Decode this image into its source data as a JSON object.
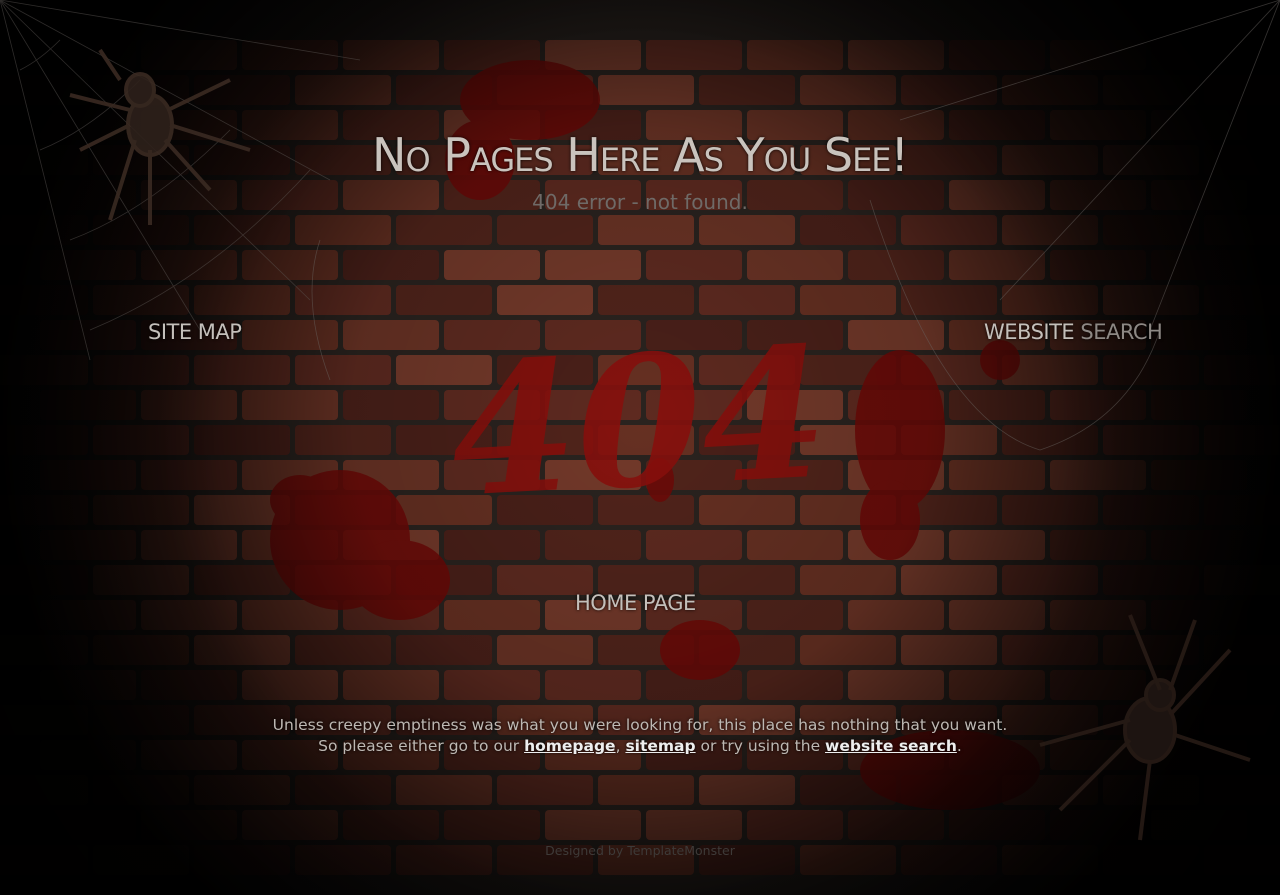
{
  "header": {
    "title": "No Pages Here As You See!",
    "subtitle": "404 error - not found."
  },
  "wall": {
    "graffiti_text": "404"
  },
  "nav": {
    "site_map": "SITE MAP",
    "website_search_part1": "WEBSITE",
    "website_search_part2": " SEARCH",
    "home_page": "HOME PAGE"
  },
  "message": {
    "line1": "Unless creepy emptiness was what you were looking for, this place has nothing that you want.",
    "line2_prefix": "So please either go to our ",
    "link_homepage": "homepage",
    "sep1": ", ",
    "link_sitemap": "sitemap",
    "line2_middle": " or try using the ",
    "link_search": "website search",
    "line2_suffix": "."
  },
  "footer": {
    "credit": "Designed by TemplateMonster"
  },
  "colors": {
    "background": "#000000",
    "brick": "#5e2a20",
    "mortar": "#2a231f",
    "blood": "#7a0b08",
    "title_text": "#c9c3bd",
    "link_underline": "#eeeeee"
  },
  "icons": [
    "spider-icon",
    "spider-icon",
    "cobweb-icon",
    "cobweb-icon"
  ]
}
